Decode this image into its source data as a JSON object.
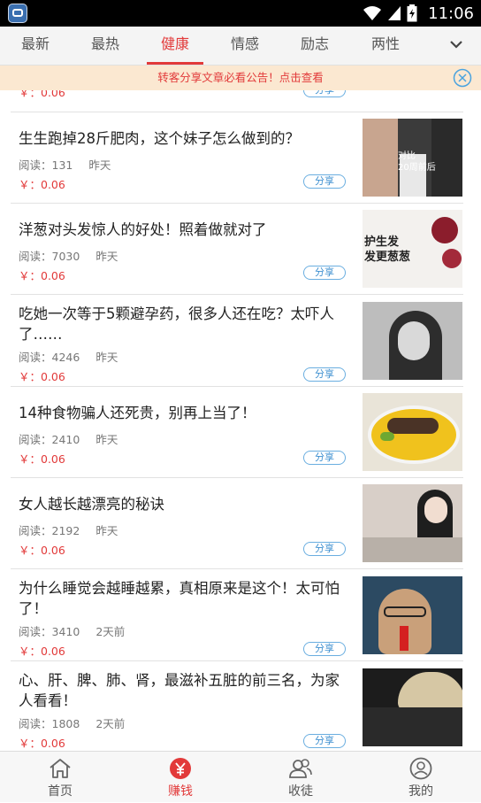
{
  "status_bar": {
    "time": "11:06"
  },
  "tabs": [
    {
      "label": "最新"
    },
    {
      "label": "最热"
    },
    {
      "label": "健康"
    },
    {
      "label": "情感"
    },
    {
      "label": "励志"
    },
    {
      "label": "两性"
    }
  ],
  "active_tab": "健康",
  "notice": {
    "text": "转客分享文章必看公告！点击查看"
  },
  "share_label": "分享",
  "partial_item": {
    "price": "￥：0.06"
  },
  "feed": [
    {
      "title": "生生跑掉28斤肥肉，这个妹子怎么做到的？",
      "reads": "阅读：131",
      "date": "昨天",
      "price": "￥：0.06",
      "thumb_text": "对比\n20周前后"
    },
    {
      "title": "洋葱对头发惊人的好处！照着做就对了",
      "reads": "阅读：7030",
      "date": "昨天",
      "price": "￥：0.06",
      "thumb_text": "护生发\n发更葱葱"
    },
    {
      "title": "吃她一次等于5颗避孕药，很多人还在吃？太吓人了……",
      "reads": "阅读：4246",
      "date": "昨天",
      "price": "￥：0.06"
    },
    {
      "title": "14种食物骗人还死贵，别再上当了！",
      "reads": "阅读：2410",
      "date": "昨天",
      "price": "￥：0.06"
    },
    {
      "title": "女人越长越漂亮的秘诀",
      "reads": "阅读：2192",
      "date": "昨天",
      "price": "￥：0.06"
    },
    {
      "title": "为什么睡觉会越睡越累，真相原来是这个！太可怕了！",
      "reads": "阅读：3410",
      "date": "2天前",
      "price": "￥：0.06"
    },
    {
      "title": "心、肝、脾、肺、肾，最滋补五脏的前三名，为家人看看！",
      "reads": "阅读：1808",
      "date": "2天前",
      "price": "￥：0.06"
    }
  ],
  "bottom_nav": [
    {
      "label": "首页",
      "icon": "home-icon"
    },
    {
      "label": "赚钱",
      "icon": "yuan-icon"
    },
    {
      "label": "收徒",
      "icon": "people-icon"
    },
    {
      "label": "我的",
      "icon": "profile-icon"
    }
  ],
  "colors": {
    "accent": "#e23a3a",
    "share_blue": "#3d8fd0",
    "notice_bg": "#fbe8d1"
  }
}
